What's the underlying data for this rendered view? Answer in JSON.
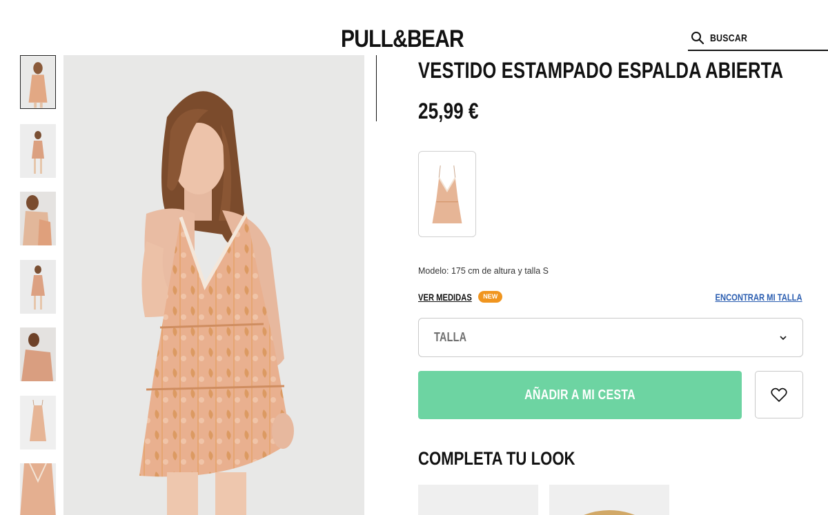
{
  "header": {
    "logo": "PULL&BEAR",
    "search_label": "BUSCAR"
  },
  "gallery": {
    "thumbnail_count": 7,
    "active_index": 0
  },
  "product": {
    "title": "VESTIDO ESTAMPADO ESPALDA ABIERTA",
    "price": "25,99 €",
    "model_info": "Modelo: 175 cm de altura y talla S",
    "measures_link": "VER MEDIDAS",
    "measures_badge": "NEW",
    "find_size_link": "ENCONTRAR MI TALLA",
    "size_placeholder": "TALLA",
    "add_to_cart": "AÑADIR A MI CESTA"
  },
  "look": {
    "title": "COMPLETA TU LOOK"
  },
  "colors": {
    "accent_green": "#6dd4a2",
    "badge_orange": "#f0951f",
    "link_blue": "#2a5db0",
    "dress_peach": "#e6ad86"
  },
  "icons": {
    "search": "search-icon",
    "chevron": "chevron-down-icon",
    "heart": "heart-icon"
  }
}
